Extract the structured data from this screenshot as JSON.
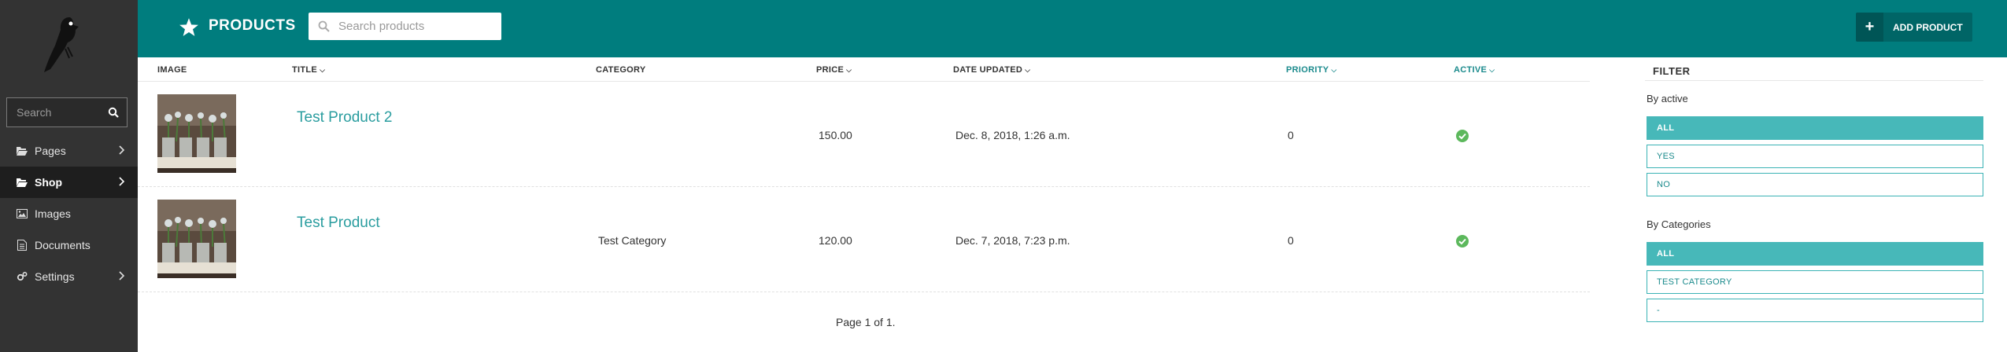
{
  "sidebar": {
    "search_placeholder": "Search",
    "items": [
      {
        "label": "Pages",
        "icon": "folder-open-icon"
      },
      {
        "label": "Shop",
        "icon": "folder-open-icon"
      },
      {
        "label": "Images",
        "icon": "image-icon"
      },
      {
        "label": "Documents",
        "icon": "document-icon"
      },
      {
        "label": "Settings",
        "icon": "cogs-icon"
      }
    ]
  },
  "header": {
    "title": "PRODUCTS",
    "search_placeholder": "Search products",
    "add_label": "ADD PRODUCT"
  },
  "table": {
    "columns": {
      "image": "IMAGE",
      "title": "TITLE",
      "category": "CATEGORY",
      "price": "PRICE",
      "date": "DATE UPDATED",
      "priority": "PRIORITY",
      "active": "ACTIVE"
    },
    "rows": [
      {
        "title": "Test Product 2",
        "category": "",
        "price": "150.00",
        "date": "Dec. 8, 2018, 1:26 a.m.",
        "priority": "0"
      },
      {
        "title": "Test Product",
        "category": "Test Category",
        "price": "120.00",
        "date": "Dec. 7, 2018, 7:23 p.m.",
        "priority": "0"
      }
    ],
    "pager": "Page 1 of 1."
  },
  "filter": {
    "heading": "FILTER",
    "active_label": "By active",
    "active_options": [
      "ALL",
      "YES",
      "NO"
    ],
    "categories_label": "By Categories",
    "category_options": [
      "ALL",
      "TEST CATEGORY",
      "-"
    ]
  },
  "colors": {
    "brand": "#007d7e",
    "sidebar": "#333333",
    "accent": "#47b8b9",
    "link": "#2a9d9f",
    "success": "#5cb85c"
  }
}
